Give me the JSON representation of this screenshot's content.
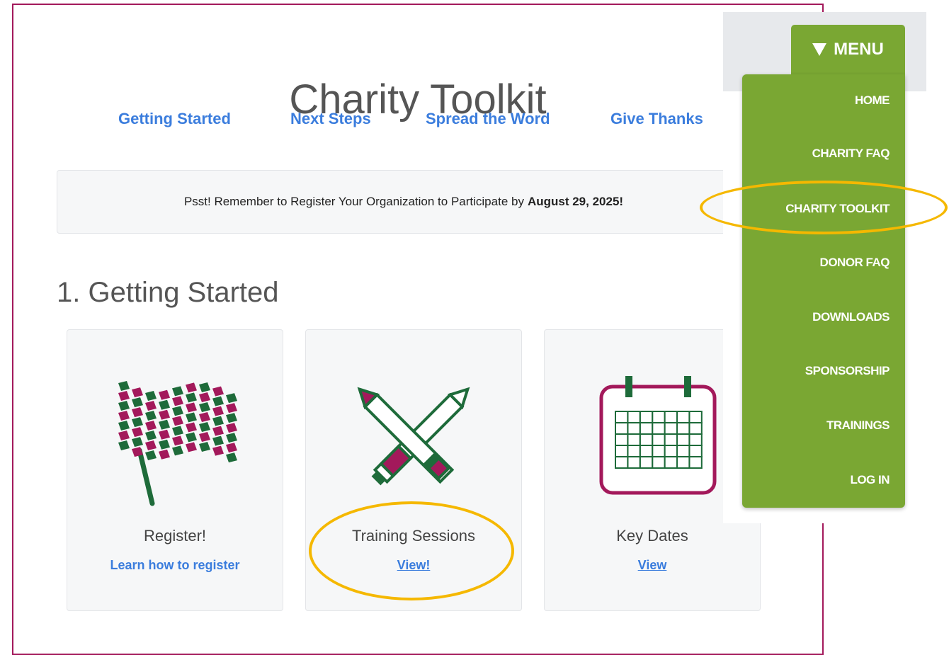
{
  "page": {
    "title": "Charity Toolkit",
    "subnav": [
      "Getting Started",
      "Next Steps",
      "Spread the Word",
      "Give Thanks"
    ],
    "notice": {
      "text": "Psst! Remember to Register Your Organization to Participate by",
      "date": "August 29, 2025!"
    },
    "section_heading": "1. Getting Started",
    "cards": [
      {
        "title": "Register!",
        "link": "Learn how to register",
        "icon": "checkered-flag-icon"
      },
      {
        "title": "Training Sessions",
        "link": "View!",
        "icon": "crossed-pencils-icon"
      },
      {
        "title": "Key Dates",
        "link": "View",
        "icon": "calendar-icon"
      }
    ]
  },
  "menu": {
    "toggle_label": "MENU",
    "toggle_icon": "triangle-down-icon",
    "items": [
      "HOME",
      "CHARITY FAQ",
      "CHARITY TOOLKIT",
      "DONOR FAQ",
      "DOWNLOADS",
      "SPONSORSHIP",
      "TRAININGS",
      "LOG IN"
    ]
  },
  "colors": {
    "menu_green": "#7aa733",
    "link_blue": "#3b7ddd",
    "accent_magenta": "#a3195b",
    "icon_green": "#1e6b3a",
    "highlight_yellow": "#f5b800"
  }
}
